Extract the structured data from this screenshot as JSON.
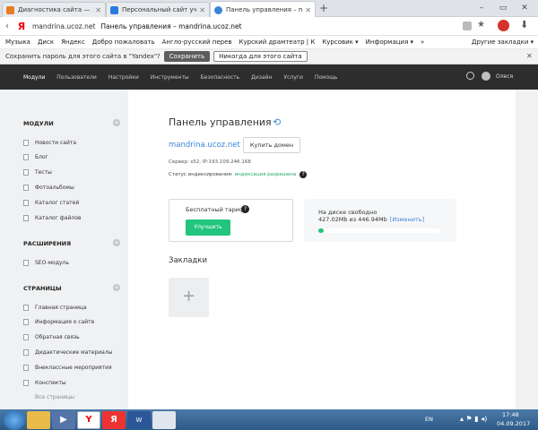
{
  "browser": {
    "tabs": [
      {
        "title": "Диагностика сайта — man",
        "active": false,
        "color": "#e67e22"
      },
      {
        "title": "Персональный сайт учител",
        "active": false,
        "color": "#2a7ae2"
      },
      {
        "title": "Панель управления – ma",
        "active": true,
        "color": "#3a86d9"
      }
    ],
    "url_host": "mandrina.ucoz.net",
    "url_title": "Панель управления – mandrina.ucoz.net",
    "bookmarks": [
      "Музыка",
      "Диск",
      "Яндекс",
      "Добро пожаловать",
      "Англо-русский перев",
      "Курский драмтеатр | К",
      "Курсовик ▾",
      "Информация ▾",
      "»"
    ],
    "other_bookmarks": "Другие закладки ▾",
    "password_prompt": "Сохранить пароль для этого сайта в \"Yandex\"?",
    "save_label": "Сохранить",
    "never_label": "Никогда для этого сайта",
    "close_glyph": "✕"
  },
  "nav": {
    "items": [
      "Модули",
      "Пользователи",
      "Настройки",
      "Инструменты",
      "Безопасность",
      "Дизайн",
      "Услуги",
      "Помощь"
    ],
    "user_name": "Олеся"
  },
  "sidebar": {
    "sections": [
      {
        "title": "МОДУЛИ",
        "items": [
          "Новости сайта",
          "Блог",
          "Тесты",
          "Фотоальбомы",
          "Каталог статей",
          "Каталог файлов"
        ]
      },
      {
        "title": "РАСШИРЕНИЯ",
        "items": [
          "SEO-модуль"
        ]
      },
      {
        "title": "СТРАНИЦЫ",
        "items": [
          "Главная страница",
          "Информация о сайте",
          "Обратная связь",
          "Дидактические материалы",
          "Внеклассные мероприятия",
          "Конспекты",
          "Все страницы"
        ]
      }
    ]
  },
  "main": {
    "title": "Панель управления",
    "site_domain": "mandrina.ucoz.net",
    "buy_domain": "Купить домен",
    "server_info": "Сервер: s52, IP:193.109.246.168",
    "index_label": "Статус индексирования:",
    "index_value": "индексация разрешена",
    "tariff_title": "Бесплатный тариф",
    "upgrade_label": "Улучшить",
    "disk_title": "На диске свободно",
    "disk_text": "427.02Mb из 446.94Mb",
    "disk_change": "[Изменить]",
    "disk_free_fraction": 0.955,
    "bookmarks_title": "Закладки",
    "add_glyph": "+"
  },
  "taskbar": {
    "lang": "EN",
    "time": "17:48",
    "date": "04.09.2017"
  }
}
